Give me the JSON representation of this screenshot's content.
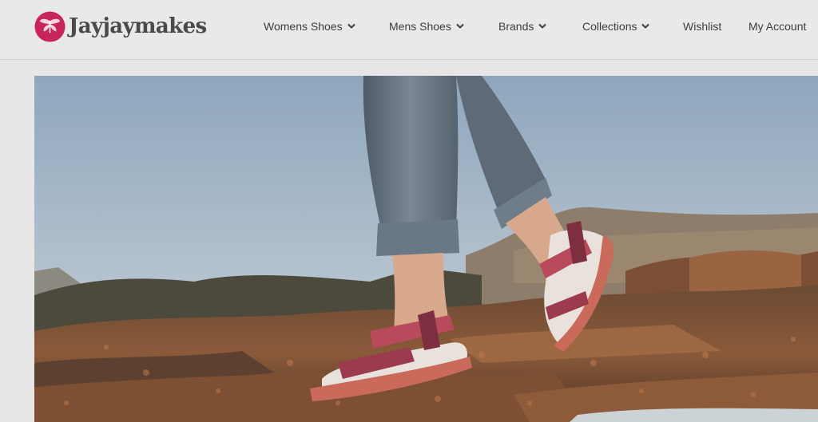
{
  "brand": {
    "name": "Jayjaymakes",
    "accent_color": "#c8245e",
    "logo_icon": "butterfly-logo-icon"
  },
  "nav": {
    "items": [
      {
        "label": "Womens Shoes",
        "dropdown": true,
        "icon": "chevron-down-icon"
      },
      {
        "label": "Mens Shoes",
        "dropdown": true,
        "icon": "chevron-down-icon"
      },
      {
        "label": "Brands",
        "dropdown": true,
        "icon": "chevron-down-icon"
      },
      {
        "label": "Collections",
        "dropdown": true,
        "icon": "chevron-down-icon"
      },
      {
        "label": "Wishlist",
        "dropdown": false
      },
      {
        "label": "My Account",
        "dropdown": false
      }
    ]
  },
  "hero": {
    "image_icon": "hero-sandals-photo",
    "colors": {
      "sky": "#9fb3c8",
      "rock": "#8a5a3a",
      "denim": "#5f6e7e",
      "sandal_strap": "#b84a5c"
    }
  }
}
